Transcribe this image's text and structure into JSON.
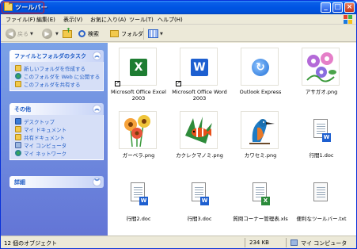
{
  "window": {
    "title": "ツールバー"
  },
  "menu": [
    {
      "label": "ファイル(F)"
    },
    {
      "label": "編集(E)"
    },
    {
      "label": "表示(V)"
    },
    {
      "label": "お気に入り(A)"
    },
    {
      "label": "ツール(T)"
    },
    {
      "label": "ヘルプ(H)"
    }
  ],
  "toolbar": {
    "back_label": "戻る",
    "search_label": "検索",
    "folders_label": "フォルダ"
  },
  "tasks": {
    "file_folder_tasks": {
      "title": "ファイルとフォルダのタスク",
      "links": [
        {
          "label": "新しいフォルダを作成する",
          "icon": "new-folder-icon"
        },
        {
          "label": "このフォルダを Web に公開する",
          "icon": "web-publish-icon"
        },
        {
          "label": "このフォルダを共有する",
          "icon": "share-icon"
        }
      ]
    },
    "other_places": {
      "title": "その他",
      "links": [
        {
          "label": "デスクトップ",
          "icon": "desktop-icon"
        },
        {
          "label": "マイ ドキュメント",
          "icon": "my-documents-icon"
        },
        {
          "label": "共有ドキュメント",
          "icon": "shared-documents-icon"
        },
        {
          "label": "マイ コンピュータ",
          "icon": "my-computer-icon"
        },
        {
          "label": "マイ ネットワーク",
          "icon": "my-network-icon"
        }
      ]
    },
    "details": {
      "title": "詳細"
    }
  },
  "files": [
    {
      "name": "Microsoft Office Excel 2003",
      "icon": "excel-icon",
      "shortcut": true
    },
    {
      "name": "Microsoft Office Word 2003",
      "icon": "word-icon",
      "shortcut": true
    },
    {
      "name": "Outlook Express",
      "icon": "outlook-express-icon",
      "shortcut": false
    },
    {
      "name": "アサガオ.png",
      "icon": "morning-glory-image",
      "shortcut": false
    },
    {
      "name": "ガーベラ.png",
      "icon": "gerbera-image",
      "shortcut": false
    },
    {
      "name": "カクレクマノミ.png",
      "icon": "clownfish-image",
      "shortcut": false
    },
    {
      "name": "カワセミ.png",
      "icon": "kingfisher-image",
      "shortcut": false
    },
    {
      "name": "行間1.doc",
      "icon": "word-document-icon",
      "shortcut": false
    },
    {
      "name": "行間2.doc",
      "icon": "word-document-icon",
      "shortcut": false
    },
    {
      "name": "行間3.doc",
      "icon": "word-document-icon",
      "shortcut": false
    },
    {
      "name": "質問コーナー管理表.xls",
      "icon": "excel-document-icon",
      "shortcut": false
    },
    {
      "name": "便利なツールバー.txt",
      "icon": "text-document-icon",
      "shortcut": false
    }
  ],
  "status": {
    "objects": "12 個のオブジェクト",
    "size": "234 KB",
    "location": "マイ コンピュータ"
  }
}
